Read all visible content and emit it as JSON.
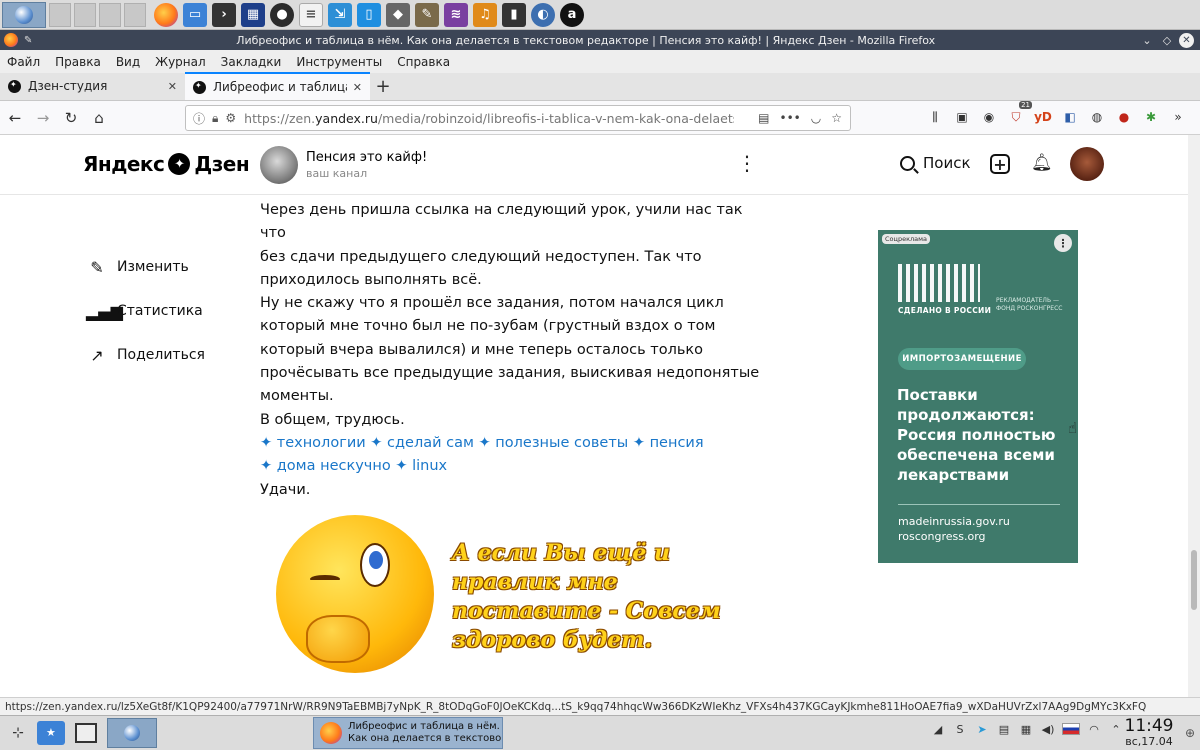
{
  "window": {
    "title": "Либреофис и таблица в нём. Как она делается в текстовом редакторе | Пенсия это кайф! | Яндекс Дзен - Mozilla Firefox"
  },
  "menubar": [
    "Файл",
    "Правка",
    "Вид",
    "Журнал",
    "Закладки",
    "Инструменты",
    "Справка"
  ],
  "tabs": [
    {
      "label": "Дзен-студия",
      "active": false
    },
    {
      "label": "Либреофис и таблица в нём",
      "active": true
    }
  ],
  "url": {
    "prefix": "https://zen.",
    "domain": "yandex.ru",
    "path": "/media/robinzoid/libreofis-i-tablica-v-nem-kak-ona-delaetsia-v"
  },
  "extensions": {
    "badge_count": "21",
    "yd_label": "yD"
  },
  "header": {
    "logo_left": "Яндекс",
    "logo_right": "Дзен",
    "channel_name": "Пенсия это кайф!",
    "channel_sub": "ваш канал",
    "search_label": "Поиск"
  },
  "side_actions": [
    {
      "label": "Изменить",
      "icon": "pencil-icon"
    },
    {
      "label": "Статистика",
      "icon": "stats-icon"
    },
    {
      "label": "Поделиться",
      "icon": "share-icon"
    }
  ],
  "article": {
    "lines": [
      "Через день пришла ссылка на следующий урок, учили нас так что",
      "без сдачи предыдущего следующий недоступен. Так что",
      "приходилось выполнять всё.",
      "Ну не скажу что я прошёл все задания, потом начался цикл",
      "который мне точно был не по-зубам (грустный вздох о том",
      "который вчера вывалился) и мне теперь осталось только",
      "прочёсывать все предыдущие задания, выискивая недопонятые",
      "моменты.",
      "В общем, трудюсь."
    ],
    "tags_line1": "✦ технологии ✦ сделай сам ✦ полезные советы ✦ пенсия",
    "tags_line2": "✦ дома нескучно ✦ linux",
    "closing": "Удачи.",
    "image_text": "А если Вы ещё и нравлик мне поставите - Совсем здорово будет."
  },
  "ad": {
    "badge": "Соцреклама",
    "made_in": "СДЕЛАНО В РОССИИ",
    "advertiser": "РЕКЛАМОДАТЕЛЬ — ФОНД РОСКОНГРЕСС",
    "pill": "ИМПОРТОЗАМЕЩЕНИЕ",
    "headline": "Поставки продолжаются: Россия полностью обеспечена всеми лекарствами",
    "link1": "madeinrussia.gov.ru",
    "link2": "roscongress.org",
    "bg_color": "#3f7a6b"
  },
  "statusbar": {
    "url": "https://zen.yandex.ru/lz5XeGt8f/K1QP92400/a77971NrW/RR9N9TaEBMBj7yNpK_R_8tODqGoF0JOeKCKdq...tS_k9qq74hhqcWw366DKzWIeKhz_VFXs4h437KGCayKJkmhe811HoOAE7fia9_wXDaHUVrZxl7AAg9DgMYc3KxFQ"
  },
  "taskbar": {
    "task_line1": "Либреофис и таблица в нём.",
    "task_line2": "Как она делается в текстово...",
    "clock_time": "11:49",
    "clock_date": "вс,17.04"
  }
}
